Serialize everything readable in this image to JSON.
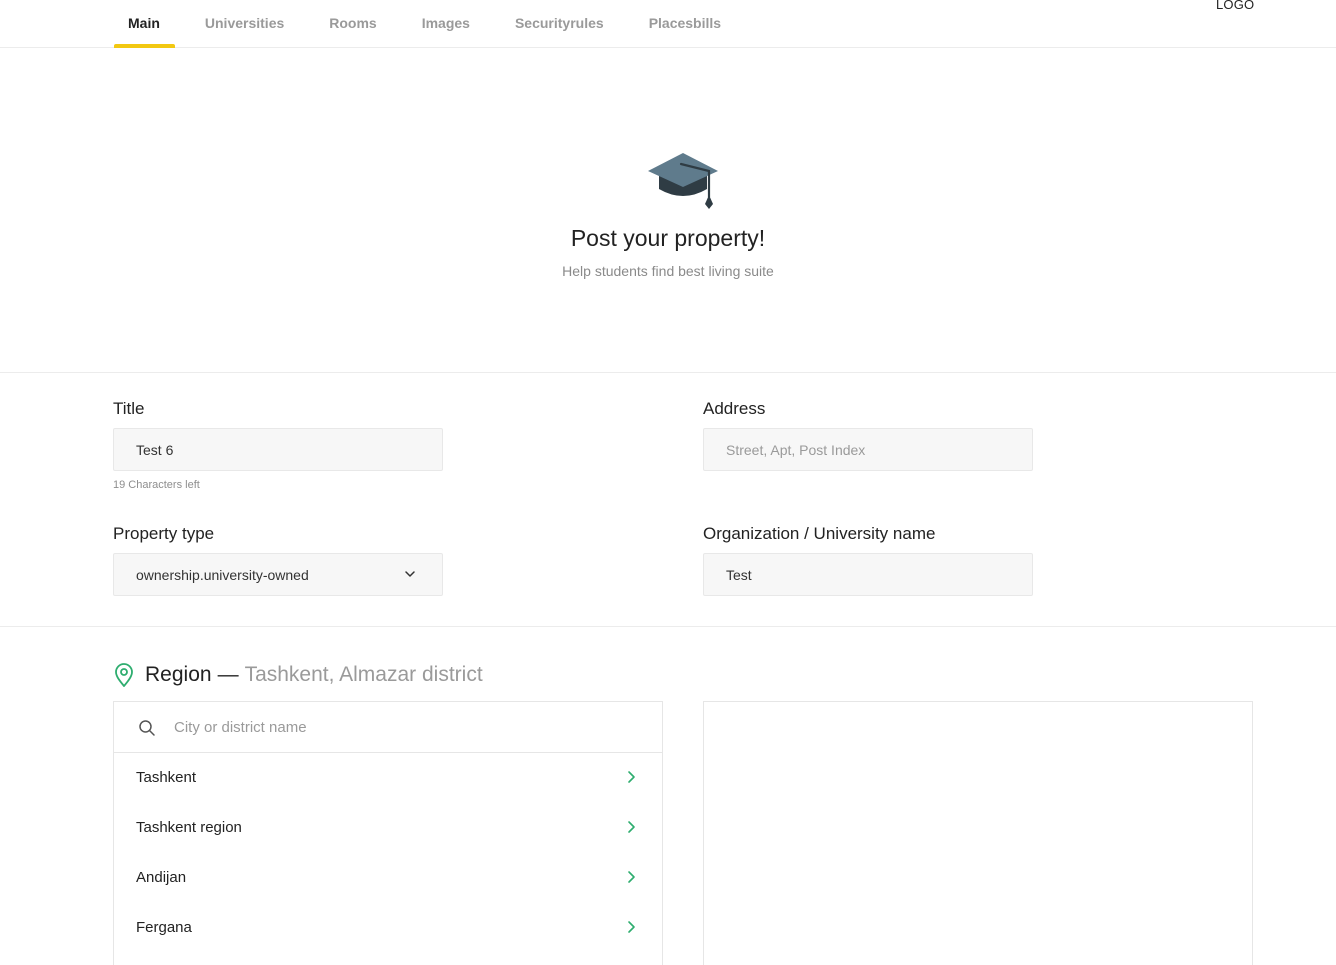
{
  "nav": {
    "tabs": [
      {
        "label": "Main",
        "active": true
      },
      {
        "label": "Universities",
        "active": false
      },
      {
        "label": "Rooms",
        "active": false
      },
      {
        "label": "Images",
        "active": false
      },
      {
        "label": "Securityrules",
        "active": false
      },
      {
        "label": "Placesbills",
        "active": false
      }
    ],
    "logo": "LOGO"
  },
  "hero": {
    "icon": "graduation-cap-icon",
    "title": "Post your property!",
    "subtitle": "Help students find best living suite"
  },
  "form": {
    "title": {
      "label": "Title",
      "value": "Test 6",
      "hint": "19 Characters left"
    },
    "address": {
      "label": "Address",
      "value": "",
      "placeholder": "Street, Apt, Post Index"
    },
    "property_type": {
      "label": "Property type",
      "value": "ownership.university-owned"
    },
    "organization": {
      "label": "Organization / University name",
      "value": "Test"
    }
  },
  "region": {
    "label": "Region",
    "separator": "—",
    "value": "Tashkent, Almazar district",
    "search_placeholder": "City or district name",
    "items": [
      {
        "label": "Tashkent"
      },
      {
        "label": "Tashkent region"
      },
      {
        "label": "Andijan"
      },
      {
        "label": "Fergana"
      }
    ]
  },
  "colors": {
    "accent": "#f2c811",
    "pin": "#2ead6f",
    "chevron": "#2ead6f",
    "cap_top": "#5f7b8c",
    "cap_base": "#2f3c44"
  }
}
